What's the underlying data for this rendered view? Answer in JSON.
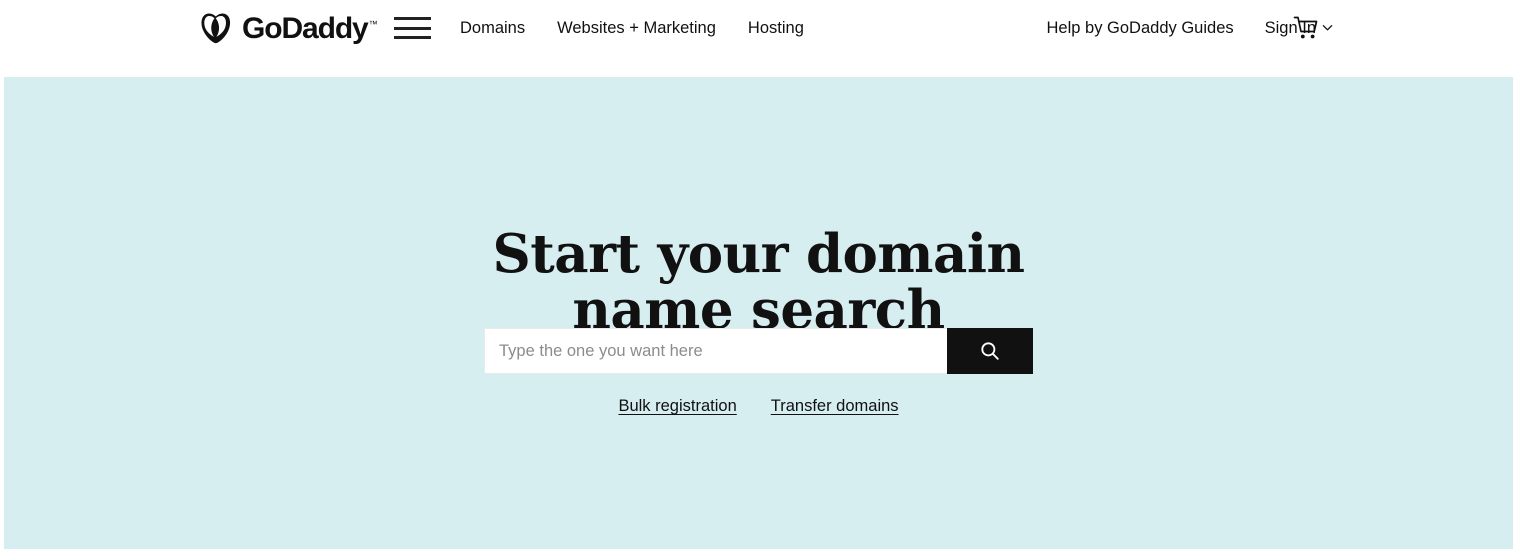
{
  "header": {
    "logo": {
      "name": "GoDaddy",
      "trademark": "™",
      "icon": "godaddy-heart-logo"
    },
    "menu_icon": "hamburger-menu-icon",
    "nav_left": [
      {
        "label": "Domains"
      },
      {
        "label": "Websites + Marketing"
      },
      {
        "label": "Hosting"
      }
    ],
    "nav_right": [
      {
        "label": "Help by GoDaddy Guides",
        "icon": null
      },
      {
        "label": "Sign In",
        "icon": "chevron-down-icon"
      }
    ],
    "cart_icon": "shopping-cart-icon"
  },
  "hero": {
    "title": "Start your domain\nname search",
    "search": {
      "placeholder": "Type the one you want here",
      "value": "",
      "button_icon": "search-icon"
    },
    "links": [
      {
        "label": "Bulk registration"
      },
      {
        "label": "Transfer domains"
      }
    ]
  },
  "colors": {
    "hero_background": "#d7eef1",
    "header_background": "#ffffff",
    "text": "#111111",
    "placeholder": "#8c8c8c",
    "button": "#111111"
  }
}
